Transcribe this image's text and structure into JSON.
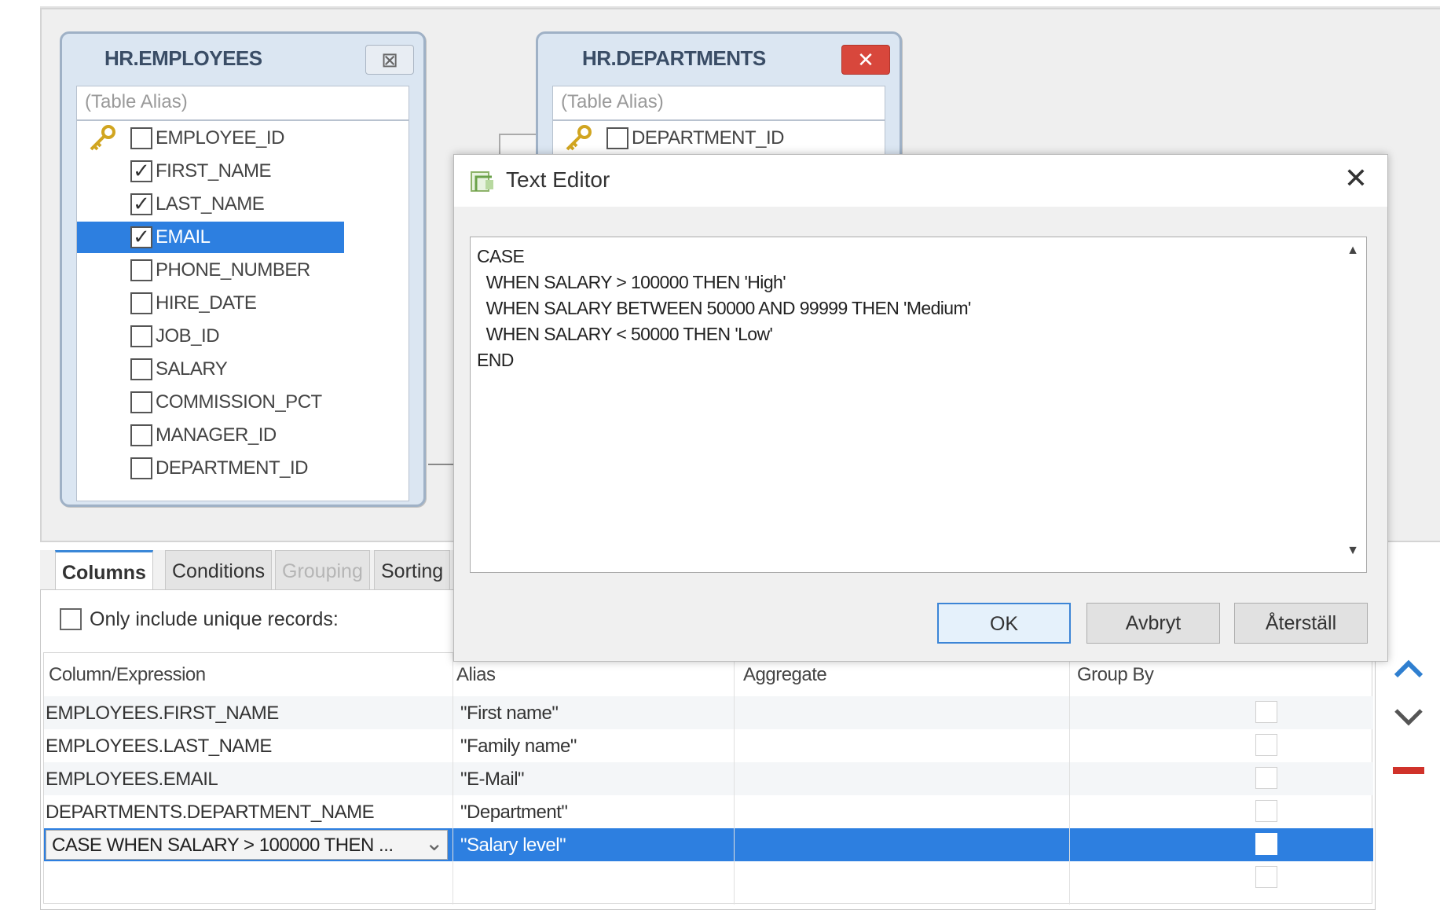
{
  "tables": [
    {
      "title": "HR.EMPLOYEES",
      "alias_placeholder": "(Table Alias)",
      "columns": [
        {
          "name": "EMPLOYEE_ID",
          "checked": false,
          "key": true
        },
        {
          "name": "FIRST_NAME",
          "checked": true
        },
        {
          "name": "LAST_NAME",
          "checked": true
        },
        {
          "name": "EMAIL",
          "checked": true,
          "selected": true
        },
        {
          "name": "PHONE_NUMBER",
          "checked": false
        },
        {
          "name": "HIRE_DATE",
          "checked": false
        },
        {
          "name": "JOB_ID",
          "checked": false
        },
        {
          "name": "SALARY",
          "checked": false
        },
        {
          "name": "COMMISSION_PCT",
          "checked": false
        },
        {
          "name": "MANAGER_ID",
          "checked": false
        },
        {
          "name": "DEPARTMENT_ID",
          "checked": false
        }
      ]
    },
    {
      "title": "HR.DEPARTMENTS",
      "alias_placeholder": "(Table Alias)",
      "columns": [
        {
          "name": "DEPARTMENT_ID",
          "checked": false,
          "key": true
        }
      ]
    }
  ],
  "tabs": [
    "Columns",
    "Conditions",
    "Grouping",
    "Sorting"
  ],
  "unique_records_label": "Only include unique records:",
  "grid": {
    "headers": [
      "Column/Expression",
      "Alias",
      "Aggregate",
      "Group By"
    ],
    "rows": [
      {
        "expr": "EMPLOYEES.FIRST_NAME",
        "alias": "\"First name\""
      },
      {
        "expr": "EMPLOYEES.LAST_NAME",
        "alias": "\"Family name\""
      },
      {
        "expr": "EMPLOYEES.EMAIL",
        "alias": "\"E-Mail\""
      },
      {
        "expr": "DEPARTMENTS.DEPARTMENT_NAME",
        "alias": "\"Department\""
      },
      {
        "expr": "CASE  WHEN SALARY > 100000 THEN ...",
        "alias": "\"Salary level\""
      },
      {
        "expr": "",
        "alias": ""
      }
    ]
  },
  "dialog": {
    "title": "Text Editor",
    "close_glyph": "✕",
    "text": "CASE\n  WHEN SALARY > 100000 THEN 'High'\n  WHEN SALARY BETWEEN 50000 AND 99999 THEN 'Medium'\n  WHEN SALARY < 50000 THEN 'Low'\nEND",
    "buttons": {
      "ok": "OK",
      "cancel": "Avbryt",
      "reset": "Återställ"
    }
  },
  "glyphs": {
    "check": "✓",
    "chevron_down": "⌄",
    "scroll_up": "▲",
    "scroll_down": "▼",
    "table_close": "⊠",
    "table_close_active": "✕"
  },
  "colors": {
    "selection": "#2d7fe0",
    "accent_up": "#2f7fd0",
    "accent_remove": "#d0322a"
  }
}
